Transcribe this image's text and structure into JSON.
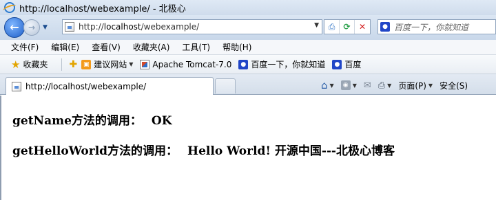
{
  "window": {
    "title": "http://localhost/webexample/ - 北极心"
  },
  "nav": {
    "address_scheme": "http://",
    "address_host": "localhost",
    "address_path": "/webexample/",
    "search_placeholder": "百度一下，你就知道"
  },
  "menu": {
    "items": [
      "文件(F)",
      "编辑(E)",
      "查看(V)",
      "收藏夹(A)",
      "工具(T)",
      "帮助(H)"
    ]
  },
  "favorites": {
    "label": "收藏夹",
    "items": [
      "建议网站",
      "Apache Tomcat-7.0",
      "百度一下，你就知道",
      "百度"
    ]
  },
  "tab": {
    "title": "http://localhost/webexample/"
  },
  "commands": {
    "page": "页面(P)",
    "safety": "安全(S)"
  },
  "content": {
    "line1_label": "getName方法的调用：",
    "line1_value": "OK",
    "line2_label": "getHelloWorld方法的调用：",
    "line2_value": "Hello World! 开源中国---北极心博客"
  }
}
